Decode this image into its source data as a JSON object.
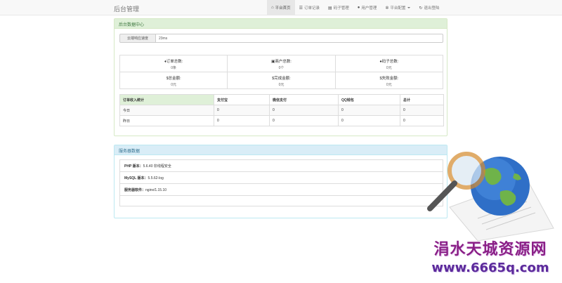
{
  "app": {
    "brand": "后台管理"
  },
  "nav": [
    {
      "label": "平台首页",
      "icon": "home-icon",
      "active": true
    },
    {
      "label": "订单记录",
      "icon": "list-icon"
    },
    {
      "label": "码子管理",
      "icon": "edit-icon"
    },
    {
      "label": "用户管理",
      "icon": "user-icon"
    },
    {
      "label": "平台配置",
      "icon": "gear-icon",
      "dropdown": true
    },
    {
      "label": "退出登陆",
      "icon": "logout-icon"
    }
  ],
  "data_panel": {
    "title": "后台数据中心",
    "latency_label": "云端响应速度",
    "latency_value": "23ms",
    "stats": [
      {
        "label": "订单总数:",
        "value": "0条",
        "icon": "fire-icon"
      },
      {
        "label": "商户总数:",
        "value": "0个",
        "icon": "card-icon"
      },
      {
        "label": "码子总数:",
        "value": "0元",
        "icon": "info-icon"
      },
      {
        "label": "总金额:",
        "value": "0元",
        "icon": "dollar-icon"
      },
      {
        "label": "完成金额:",
        "value": "0元",
        "icon": "dollar-icon"
      },
      {
        "label": "失败金额:",
        "value": "0元",
        "icon": "dollar-icon"
      }
    ],
    "income_table": {
      "headers": [
        "订单收入统计",
        "支付宝",
        "微信支付",
        "QQ钱包",
        "总计"
      ],
      "rows": [
        [
          "今日",
          "0",
          "0",
          "0",
          "0"
        ],
        [
          "昨日",
          "0",
          "0",
          "0",
          "0"
        ]
      ]
    }
  },
  "server_panel": {
    "title": "服务器数据",
    "rows": [
      {
        "label": "PHP 版本：",
        "value": "5.6.40 非线程安全"
      },
      {
        "label": "MySQL 版本：",
        "value": "5.5.62-log"
      },
      {
        "label": "服务器软件：",
        "value": "nginx/1.15.10"
      }
    ]
  },
  "watermark": {
    "line1": "涓水天城资源网",
    "line2": "www.6665q.com"
  },
  "colors": {
    "success_bg": "#dff0d8",
    "info_bg": "#d9edf7",
    "watermark": "#8a1f86"
  }
}
